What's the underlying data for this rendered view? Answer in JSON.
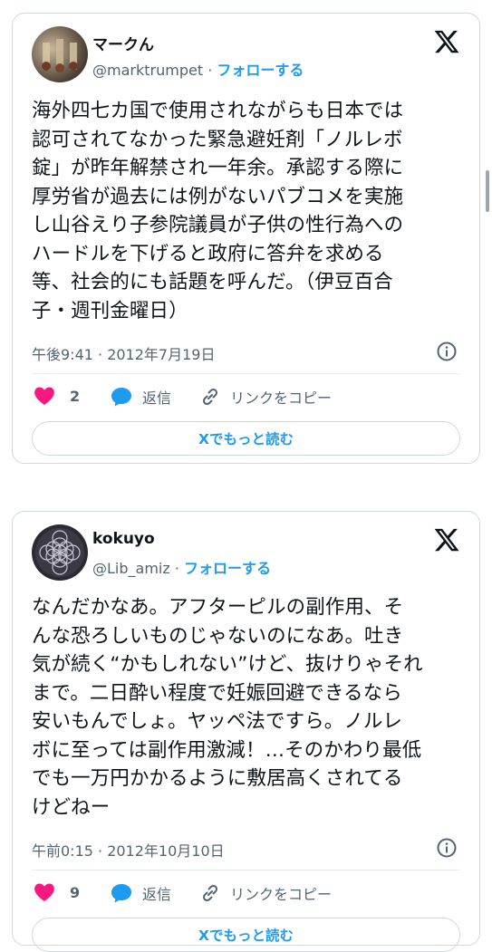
{
  "tweets": [
    {
      "name": "マークん",
      "handle": "@marktrumpet",
      "follow_label": "フォローする",
      "text": "海外四七カ国で使用されながらも日本では\n認可されてなかった緊急避妊剤「ノルレボ\n錠」が昨年解禁され一年余。承認する際に\n厚労省が過去には例がないパブコメを実施\nし山谷えり子参院議員が子供の性行為への\nハードルを下げると政府に答弁を求める\n等、社会的にも話題を呼んだ。（伊豆百合\n子・週刊金曜日）",
      "timestamp": "午後9:41 · 2012年7月19日",
      "likes": "2",
      "reply_label": "返信",
      "copy_link_label": "リンクをコピー",
      "read_more_label": "Xでもっと読む"
    },
    {
      "name": "kokuyo",
      "handle": "@Lib_amiz",
      "follow_label": "フォローする",
      "text": "なんだかなあ。アフターピルの副作用、そ\nんな恐ろしいものじゃないのになあ。吐き\n気が続く“かもしれない”けど、抜けりゃそれ\nまで。二日酔い程度で妊娠回避できるなら\n安いもんでしょ。ヤッペ法ですら。ノルレ\nボに至っては副作用激減！…そのかわり最低\nでも一万円かかるように敷居高くされてる\nけどねー",
      "timestamp": "午前0:15 · 2012年10月10日",
      "likes": "9",
      "reply_label": "返信",
      "copy_link_label": "リンクをコピー",
      "read_more_label": "Xでもっと読む"
    }
  ],
  "colors": {
    "accent": "#1d9bf0",
    "heart": "#f91880",
    "secondary_text": "#536471",
    "border": "#cfd9de"
  }
}
